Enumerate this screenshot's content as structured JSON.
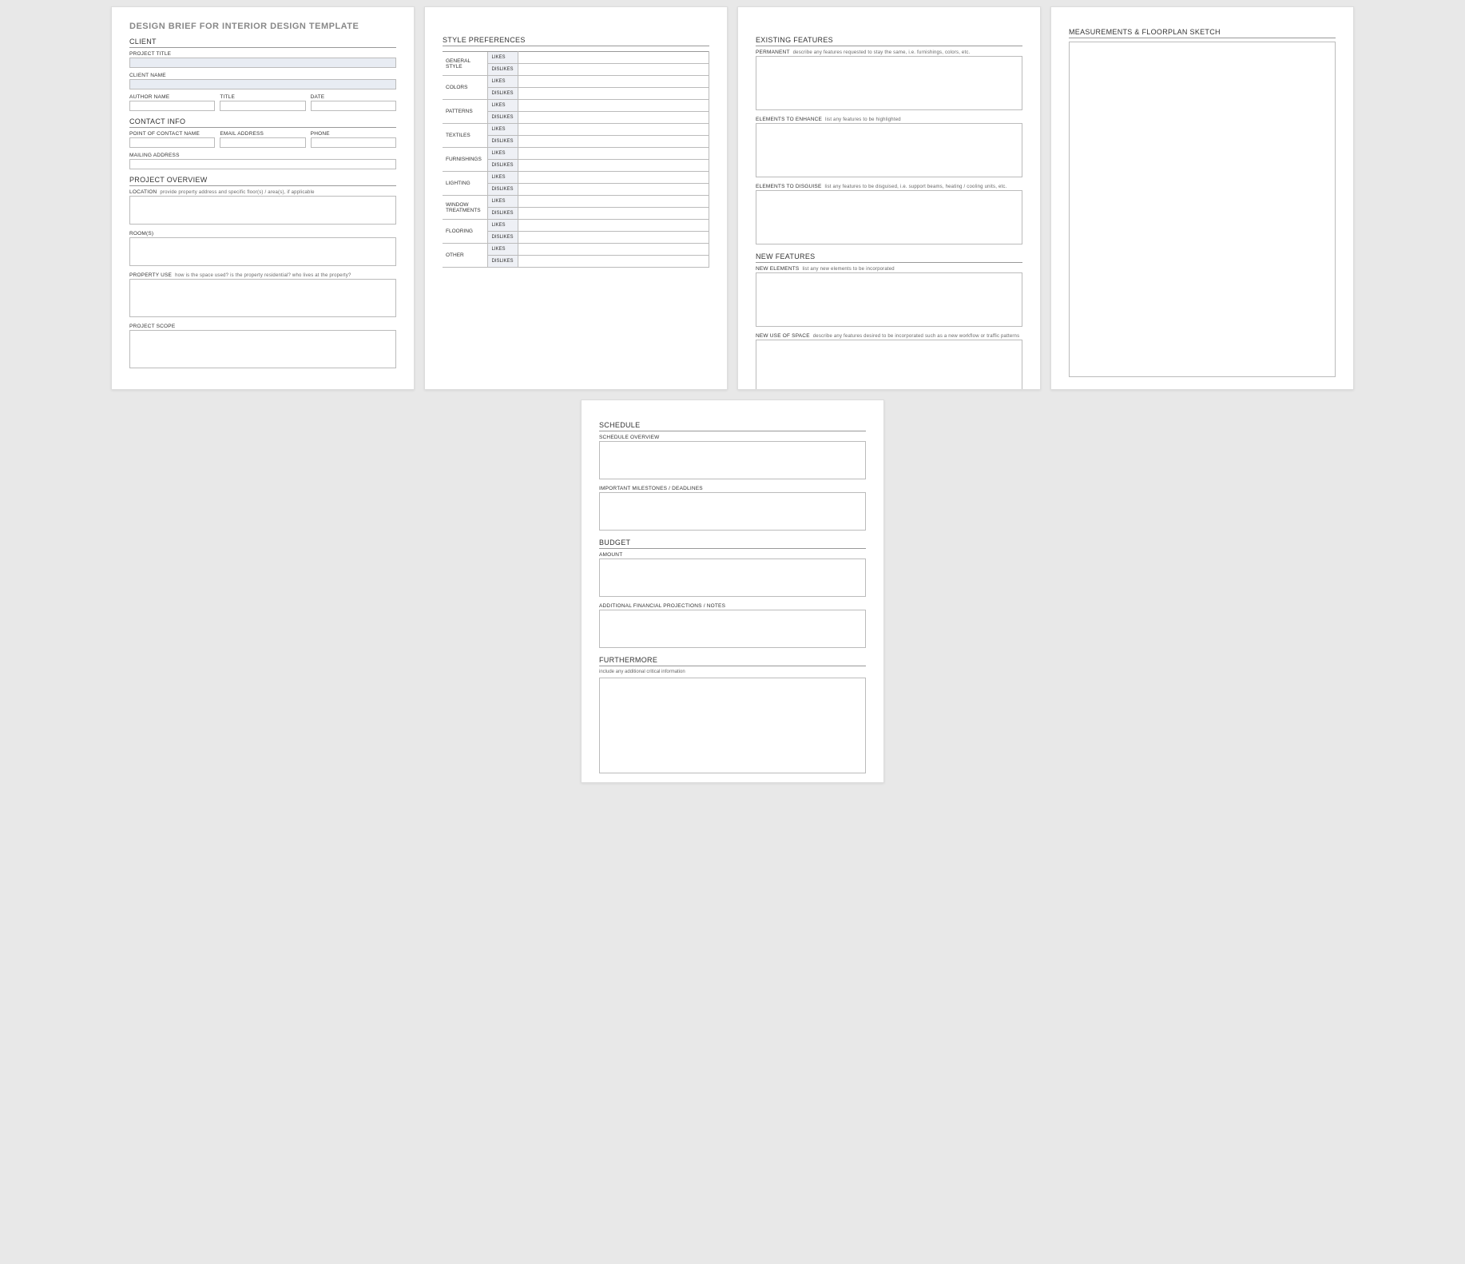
{
  "title": "DESIGN BRIEF FOR INTERIOR DESIGN TEMPLATE",
  "sections": {
    "client": "CLIENT",
    "contact": "CONTACT INFO",
    "overview": "PROJECT OVERVIEW",
    "style": "STYLE PREFERENCES",
    "existing": "EXISTING FEATURES",
    "newfeat": "NEW FEATURES",
    "sketch": "MEASUREMENTS & FLOORPLAN SKETCH",
    "schedule": "SCHEDULE",
    "budget": "BUDGET",
    "furthermore": "FURTHERMORE"
  },
  "labels": {
    "project_title": "PROJECT TITLE",
    "client_name": "CLIENT NAME",
    "author_name": "AUTHOR NAME",
    "title_lbl": "TITLE",
    "date": "DATE",
    "poc": "POINT OF CONTACT NAME",
    "email": "EMAIL ADDRESS",
    "phone": "PHONE",
    "mailing": "MAILING ADDRESS",
    "location": "LOCATION",
    "rooms": "ROOM(S)",
    "property_use": "PROPERTY USE",
    "project_scope": "PROJECT SCOPE",
    "permanent": "PERMANENT",
    "enhance": "ELEMENTS TO ENHANCE",
    "disguise": "ELEMENTS TO DISGUISE",
    "new_elements": "NEW ELEMENTS",
    "new_use": "NEW USE OF SPACE",
    "sched_overview": "SCHEDULE OVERVIEW",
    "milestones": "IMPORTANT MILESTONES / DEADLINES",
    "amount": "AMOUNT",
    "fin_notes": "ADDITIONAL FINANCIAL PROJECTIONS / NOTES",
    "likes": "LIKES",
    "dislikes": "DISLIKES"
  },
  "hints": {
    "location": "provide property address and specific floor(s) / area(s), if applicable",
    "property_use": "how is the space used?  is the property residential? who lives at the property?",
    "permanent": "describe any features requested to stay the same, i.e. furnishings, colors, etc.",
    "enhance": "list any features to be highlighted",
    "disguise": "list any features to be disguised, i.e. support beams, heating / cooling units, etc.",
    "new_elements": "list any new elements to be incorporated",
    "new_use": "describe any features desired to be incorporated such as a new workflow or traffic patterns",
    "furthermore": "include any additional critical information"
  },
  "prefs": [
    "GENERAL STYLE",
    "COLORS",
    "PATTERNS",
    "TEXTILES",
    "FURNISHINGS",
    "LIGHTING",
    "WINDOW TREATMENTS",
    "FLOORING",
    "OTHER"
  ]
}
